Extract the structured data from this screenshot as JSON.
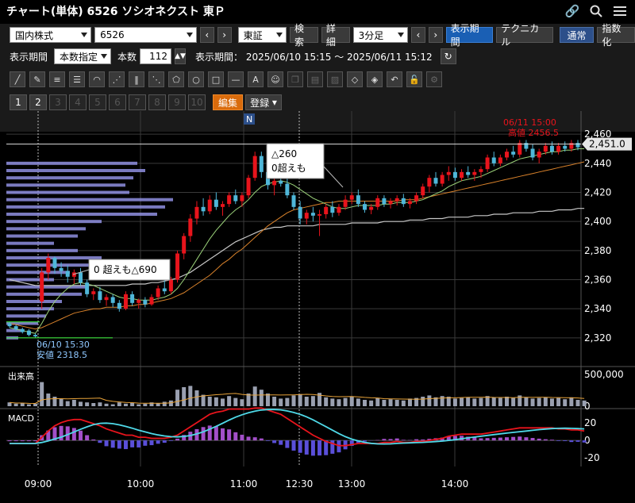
{
  "title": "チャート(単体) 6526 ソシオネクスト 東Ｐ",
  "toolbar": {
    "market_select": "国内株式",
    "code_select": "6526",
    "exchange_select": "東証",
    "search_label": "検索",
    "detail_label": "詳細",
    "interval_select": "3分足",
    "period_label": "表示期間",
    "technical_label": "テクニカル",
    "normal_label": "通常",
    "index_label": "指数化",
    "display_period_label": "表示期間",
    "count_mode_select": "本数指定",
    "count_label": "本数",
    "count_value": "112",
    "period_text": "表示期間： 2025/06/10 15:15 ～ 2025/06/11 15:12",
    "edit_label": "編集",
    "register_label": "登録",
    "pages": [
      "1",
      "2",
      "3",
      "4",
      "5",
      "6",
      "7",
      "8",
      "9",
      "10"
    ]
  },
  "colors": {
    "up": "#e8141c",
    "down": "#4fb7d9",
    "orange_ma": "#d9822b",
    "gray_ma": "#c8c8c8",
    "macd_line": "#e8141c",
    "signal_line": "#4fd9e8",
    "hist": "#a24fc8",
    "volume_profile": "#8f8fe0"
  },
  "chart_data": {
    "type": "candlestick",
    "price_axis": {
      "ticks": [
        "2,460",
        "2,440",
        "2,420",
        "2,400",
        "2,380",
        "2,360",
        "2,340",
        "2,320"
      ],
      "ylim": [
        2315,
        2465
      ]
    },
    "time_axis": {
      "ticks": [
        "09:00",
        "10:00",
        "11:00",
        "12:30",
        "13:00",
        "14:00"
      ]
    },
    "current_price": "2,451.0",
    "high_label_time": "06/11 15:00",
    "high_label_value": "高値 2456.5",
    "low_label_time": "06/10 15:30",
    "low_label_value": "安値 2318.5",
    "annotation_1_line1": "△260",
    "annotation_1_line2": "0超えも",
    "annotation_2": "0 超えも△690",
    "news_marker": "N",
    "candles": [
      [
        2330,
        2331,
        2327,
        2328
      ],
      [
        2328,
        2329,
        2325,
        2326
      ],
      [
        2326,
        2327,
        2323,
        2324
      ],
      [
        2325,
        2326,
        2321,
        2322
      ],
      [
        2322,
        2323,
        2320,
        2321
      ],
      [
        2345,
        2368,
        2340,
        2365
      ],
      [
        2365,
        2378,
        2360,
        2375
      ],
      [
        2375,
        2376,
        2364,
        2368
      ],
      [
        2368,
        2372,
        2362,
        2366
      ],
      [
        2366,
        2370,
        2358,
        2362
      ],
      [
        2362,
        2367,
        2357,
        2365
      ],
      [
        2365,
        2368,
        2356,
        2358
      ],
      [
        2358,
        2360,
        2348,
        2350
      ],
      [
        2350,
        2354,
        2346,
        2352
      ],
      [
        2352,
        2355,
        2344,
        2346
      ],
      [
        2346,
        2350,
        2342,
        2348
      ],
      [
        2348,
        2350,
        2341,
        2344
      ],
      [
        2344,
        2346,
        2338,
        2340
      ],
      [
        2340,
        2352,
        2339,
        2350
      ],
      [
        2350,
        2352,
        2342,
        2344
      ],
      [
        2344,
        2347,
        2340,
        2346
      ],
      [
        2346,
        2348,
        2341,
        2343
      ],
      [
        2343,
        2350,
        2342,
        2348
      ],
      [
        2348,
        2356,
        2346,
        2354
      ],
      [
        2354,
        2360,
        2350,
        2352
      ],
      [
        2352,
        2362,
        2350,
        2360
      ],
      [
        2360,
        2380,
        2358,
        2378
      ],
      [
        2378,
        2392,
        2374,
        2390
      ],
      [
        2390,
        2405,
        2386,
        2402
      ],
      [
        2402,
        2414,
        2398,
        2410
      ],
      [
        2410,
        2416,
        2404,
        2407
      ],
      [
        2407,
        2418,
        2405,
        2415
      ],
      [
        2415,
        2420,
        2408,
        2410
      ],
      [
        2410,
        2414,
        2404,
        2412
      ],
      [
        2412,
        2420,
        2410,
        2418
      ],
      [
        2418,
        2422,
        2412,
        2414
      ],
      [
        2414,
        2420,
        2410,
        2418
      ],
      [
        2418,
        2432,
        2416,
        2430
      ],
      [
        2430,
        2448,
        2428,
        2445
      ],
      [
        2445,
        2448,
        2430,
        2434
      ],
      [
        2434,
        2436,
        2422,
        2425
      ],
      [
        2425,
        2430,
        2418,
        2428
      ],
      [
        2428,
        2432,
        2424,
        2426
      ],
      [
        2426,
        2430,
        2416,
        2418
      ],
      [
        2418,
        2420,
        2408,
        2410
      ],
      [
        2410,
        2414,
        2398,
        2402
      ],
      [
        2402,
        2408,
        2398,
        2406
      ],
      [
        2406,
        2410,
        2400,
        2404
      ],
      [
        2404,
        2408,
        2390,
        2405
      ],
      [
        2405,
        2412,
        2402,
        2410
      ],
      [
        2410,
        2414,
        2403,
        2406
      ],
      [
        2406,
        2412,
        2404,
        2410
      ],
      [
        2410,
        2418,
        2408,
        2415
      ],
      [
        2415,
        2420,
        2412,
        2418
      ],
      [
        2418,
        2422,
        2410,
        2412
      ],
      [
        2412,
        2414,
        2406,
        2408
      ],
      [
        2408,
        2412,
        2405,
        2410
      ],
      [
        2410,
        2418,
        2408,
        2416
      ],
      [
        2416,
        2418,
        2410,
        2412
      ],
      [
        2412,
        2416,
        2409,
        2414
      ],
      [
        2414,
        2418,
        2411,
        2416
      ],
      [
        2416,
        2419,
        2410,
        2412
      ],
      [
        2412,
        2416,
        2409,
        2414
      ],
      [
        2414,
        2420,
        2412,
        2418
      ],
      [
        2418,
        2426,
        2416,
        2424
      ],
      [
        2424,
        2432,
        2420,
        2430
      ],
      [
        2430,
        2434,
        2424,
        2426
      ],
      [
        2426,
        2434,
        2424,
        2432
      ],
      [
        2432,
        2438,
        2428,
        2434
      ],
      [
        2434,
        2437,
        2428,
        2430
      ],
      [
        2430,
        2436,
        2428,
        2434
      ],
      [
        2434,
        2438,
        2430,
        2432
      ],
      [
        2432,
        2436,
        2428,
        2434
      ],
      [
        2434,
        2438,
        2430,
        2436
      ],
      [
        2436,
        2446,
        2434,
        2444
      ],
      [
        2444,
        2448,
        2438,
        2440
      ],
      [
        2440,
        2446,
        2438,
        2444
      ],
      [
        2444,
        2450,
        2442,
        2448
      ],
      [
        2448,
        2452,
        2444,
        2446
      ],
      [
        2446,
        2456,
        2444,
        2454
      ],
      [
        2454,
        2456,
        2448,
        2450
      ],
      [
        2450,
        2453,
        2442,
        2444
      ],
      [
        2444,
        2450,
        2440,
        2448
      ],
      [
        2448,
        2454,
        2446,
        2452
      ],
      [
        2452,
        2455,
        2446,
        2448
      ],
      [
        2448,
        2454,
        2446,
        2452
      ],
      [
        2452,
        2455,
        2448,
        2450
      ],
      [
        2450,
        2456,
        2448,
        2454
      ],
      [
        2454,
        2456,
        2449,
        2451
      ]
    ],
    "ma_short": [
      2327,
      2326,
      2325,
      2324,
      2323,
      2330,
      2338,
      2345,
      2350,
      2354,
      2357,
      2358,
      2357,
      2356,
      2354,
      2352,
      2350,
      2348,
      2347,
      2347,
      2346,
      2346,
      2346,
      2347,
      2348,
      2350,
      2354,
      2360,
      2367,
      2374,
      2381,
      2388,
      2394,
      2399,
      2404,
      2408,
      2411,
      2415,
      2420,
      2424,
      2426,
      2427,
      2428,
      2427,
      2425,
      2422,
      2419,
      2416,
      2414,
      2412,
      2410,
      2409,
      2409,
      2410,
      2411,
      2411,
      2411,
      2411,
      2412,
      2412,
      2413,
      2413,
      2413,
      2414,
      2415,
      2417,
      2419,
      2421,
      2424,
      2426,
      2428,
      2429,
      2430,
      2431,
      2433,
      2435,
      2437,
      2439,
      2441,
      2443,
      2444,
      2445,
      2446,
      2447,
      2448,
      2448,
      2449,
      2449,
      2450,
      2450
    ],
    "ma_mid": [
      2330,
      2329,
      2328,
      2327,
      2326,
      2327,
      2329,
      2331,
      2333,
      2335,
      2337,
      2338,
      2339,
      2340,
      2340,
      2341,
      2341,
      2341,
      2342,
      2342,
      2343,
      2343,
      2344,
      2345,
      2346,
      2347,
      2349,
      2351,
      2354,
      2357,
      2360,
      2363,
      2367,
      2371,
      2374,
      2378,
      2381,
      2385,
      2389,
      2393,
      2397,
      2400,
      2403,
      2406,
      2408,
      2409,
      2410,
      2411,
      2412,
      2413,
      2413,
      2414,
      2414,
      2414,
      2414,
      2414,
      2414,
      2414,
      2414,
      2414,
      2414,
      2415,
      2415,
      2415,
      2416,
      2417,
      2418,
      2419,
      2420,
      2421,
      2422,
      2423,
      2424,
      2425,
      2426,
      2427,
      2428,
      2429,
      2430,
      2431,
      2432,
      2433,
      2434,
      2435,
      2436,
      2437,
      2438,
      2439,
      2440,
      2441
    ],
    "ma_long": [
      2360,
      2359,
      2358,
      2357,
      2356,
      2356,
      2356,
      2356,
      2356,
      2356,
      2356,
      2356,
      2356,
      2356,
      2356,
      2356,
      2356,
      2356,
      2356,
      2357,
      2357,
      2357,
      2358,
      2358,
      2359,
      2360,
      2361,
      2363,
      2365,
      2368,
      2371,
      2374,
      2377,
      2380,
      2383,
      2386,
      2388,
      2390,
      2392,
      2394,
      2395,
      2396,
      2396,
      2397,
      2397,
      2397,
      2397,
      2397,
      2398,
      2398,
      2398,
      2398,
      2398,
      2399,
      2399,
      2399,
      2399,
      2399,
      2400,
      2400,
      2400,
      2400,
      2401,
      2401,
      2401,
      2402,
      2402,
      2402,
      2403,
      2403,
      2403,
      2403,
      2404,
      2404,
      2404,
      2405,
      2405,
      2405,
      2406,
      2406,
      2406,
      2406,
      2407,
      2407,
      2407,
      2408,
      2408,
      2408,
      2409,
      2409
    ],
    "volume_axis": {
      "ticks": [
        "500,000",
        "0"
      ],
      "ylim": [
        0,
        550000
      ]
    },
    "volume_label": "出来高",
    "macd_label": "MACD",
    "macd_axis": {
      "ticks": [
        "20",
        "0",
        "-20"
      ],
      "ylim": [
        -30,
        32
      ]
    },
    "volume_profile_levels": [
      2460,
      2455,
      2450,
      2445,
      2440,
      2435,
      2430,
      2425,
      2420,
      2415,
      2410,
      2405,
      2400,
      2395,
      2390,
      2385,
      2380,
      2375,
      2370,
      2365,
      2360,
      2355,
      2350,
      2345,
      2340,
      2335,
      2330,
      2325,
      2320
    ]
  }
}
